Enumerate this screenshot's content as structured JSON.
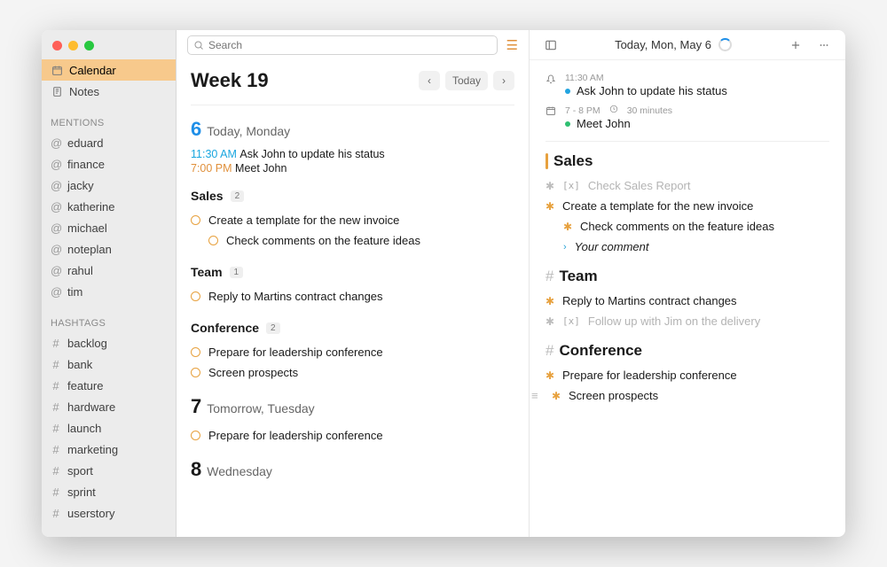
{
  "sidebar": {
    "calendar": "Calendar",
    "notes": "Notes",
    "mentions_heading": "MENTIONS",
    "mentions": [
      "eduard",
      "finance",
      "jacky",
      "katherine",
      "michael",
      "noteplan",
      "rahul",
      "tim"
    ],
    "hashtags_heading": "HASHTAGS",
    "hashtags": [
      "backlog",
      "bank",
      "feature",
      "hardware",
      "launch",
      "marketing",
      "sport",
      "sprint",
      "userstory"
    ]
  },
  "search": {
    "placeholder": "Search"
  },
  "center": {
    "week_title": "Week 19",
    "today_btn": "Today",
    "days": [
      {
        "num": "6",
        "name": "Today, Monday",
        "is_today": true,
        "timed": [
          {
            "time": "11:30 AM",
            "label": "Ask John to update his status",
            "color": "blue"
          },
          {
            "time": "7:00 PM",
            "label": "Meet John",
            "color": "orange"
          }
        ],
        "sections": [
          {
            "title": "Sales",
            "count": "2",
            "tasks": [
              {
                "text": "Create a template for the new invoice"
              },
              {
                "text": "Check comments on the feature ideas",
                "indent": true
              }
            ]
          },
          {
            "title": "Team",
            "count": "1",
            "tasks": [
              {
                "text": "Reply to Martins contract changes"
              }
            ]
          },
          {
            "title": "Conference",
            "count": "2",
            "tasks": [
              {
                "text": "Prepare for leadership conference"
              },
              {
                "text": "Screen prospects"
              }
            ]
          }
        ]
      },
      {
        "num": "7",
        "name": "Tomorrow, Tuesday",
        "is_today": false,
        "timed": [],
        "sections": [
          {
            "title": "",
            "count": "",
            "tasks": [
              {
                "text": "Prepare for leadership conference"
              }
            ]
          }
        ]
      },
      {
        "num": "8",
        "name": "Wednesday",
        "is_today": false,
        "timed": [],
        "sections": []
      }
    ]
  },
  "right": {
    "header_date": "Today, Mon, May 6",
    "events": [
      {
        "icon": "bell",
        "meta": "11:30 AM",
        "title": "Ask John to update his status",
        "dot": "blue"
      },
      {
        "icon": "calendar",
        "meta": "7 - 8 PM",
        "duration": "30 minutes",
        "title": "Meet John",
        "dot": "green"
      }
    ],
    "sections": [
      {
        "title": "Sales",
        "highlighted": true,
        "items": [
          {
            "kind": "done",
            "text": "Check Sales Report"
          },
          {
            "kind": "open",
            "text": "Create a template for the new invoice"
          },
          {
            "kind": "sub",
            "text": "Check comments on the feature ideas"
          },
          {
            "kind": "comment",
            "text": "Your comment"
          }
        ]
      },
      {
        "title": "Team",
        "items": [
          {
            "kind": "open",
            "text": "Reply to Martins contract changes"
          },
          {
            "kind": "done",
            "text": "Follow up with Jim on the delivery"
          }
        ]
      },
      {
        "title": "Conference",
        "items": [
          {
            "kind": "open",
            "text": "Prepare for leadership conference"
          },
          {
            "kind": "drag",
            "text": "Screen prospects"
          }
        ]
      }
    ]
  }
}
